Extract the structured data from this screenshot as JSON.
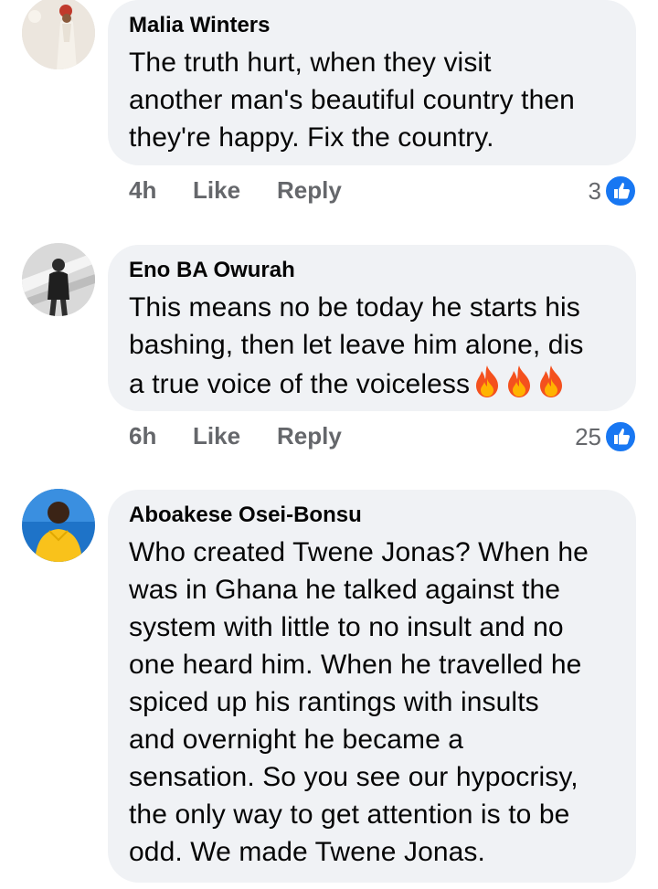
{
  "comments": [
    {
      "author": "Malia Winters",
      "text_lines": [
        "The truth hurt, when they visit",
        "another man's beautiful country then",
        "they're happy. Fix the country."
      ],
      "time": "4h",
      "like_label": "Like",
      "reply_label": "Reply",
      "reaction_count": "3"
    },
    {
      "author": "Eno BA Owurah",
      "text_lines": [
        "This means no be today he starts his",
        "bashing, then let leave him alone, dis",
        "a true voice of the voiceless"
      ],
      "emoji": [
        "fire",
        "fire",
        "fire"
      ],
      "time": "6h",
      "like_label": "Like",
      "reply_label": "Reply",
      "reaction_count": "25"
    },
    {
      "author": "Aboakese Osei-Bonsu",
      "text_lines": [
        "Who created Twene Jonas? When he",
        "was in Ghana he talked against the",
        "system with little to no insult and no",
        "one heard him. When he travelled he",
        "spiced up his rantings with insults",
        "and overnight he became a",
        "sensation. So you see our hypocrisy,",
        "the only way to get attention is to be",
        "odd. We made Twene Jonas."
      ]
    }
  ],
  "colors": {
    "bubble": "#f0f2f5",
    "muted": "#65676b",
    "like_blue": "#1877f2"
  },
  "icons": [
    "avatar-photo",
    "thumbs-up-icon",
    "fire-emoji"
  ]
}
